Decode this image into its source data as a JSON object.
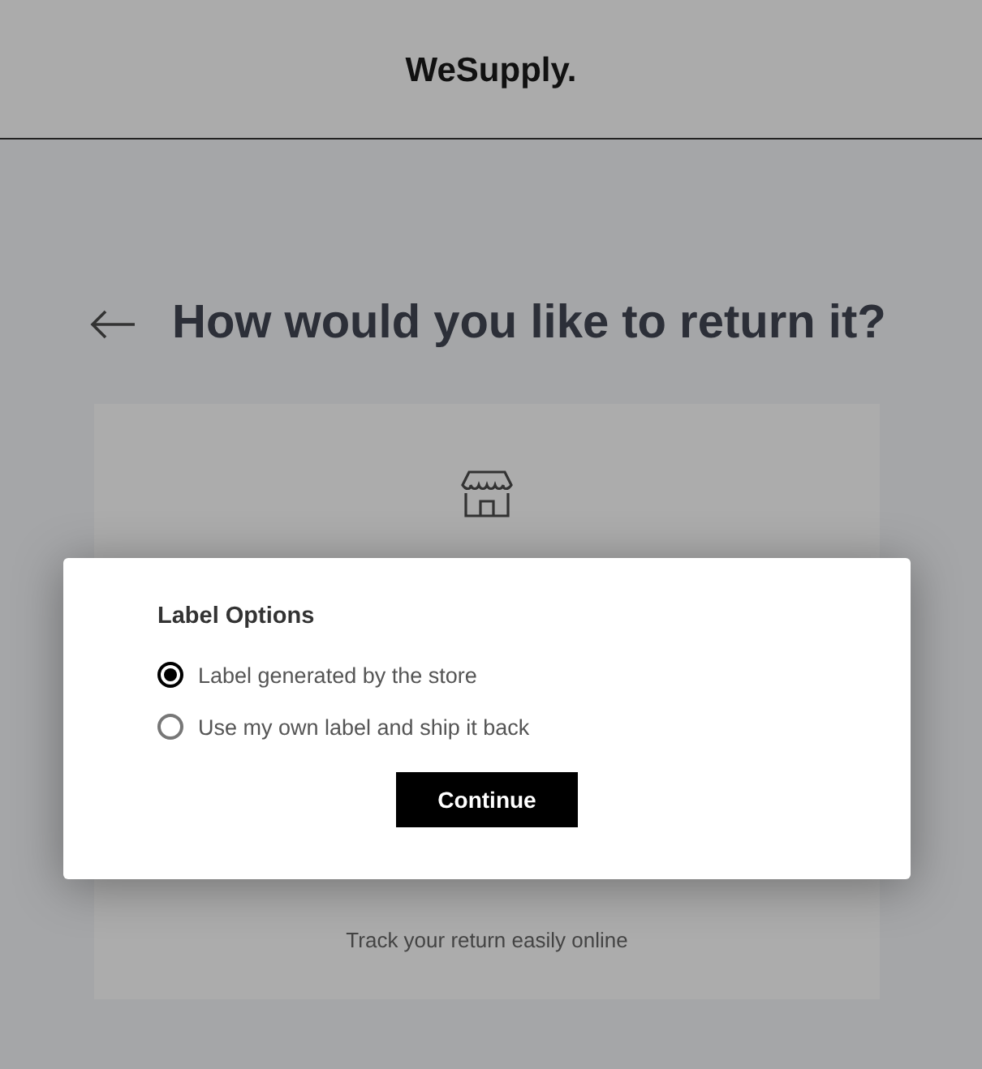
{
  "header": {
    "logo": "WeSupply."
  },
  "page": {
    "title": "How would you like to return it?"
  },
  "card": {
    "description": "Track your return easily online"
  },
  "modal": {
    "title": "Label Options",
    "options": [
      {
        "label": "Label generated by the store",
        "selected": true
      },
      {
        "label": "Use my own label and ship it back",
        "selected": false
      }
    ],
    "button": "Continue"
  }
}
